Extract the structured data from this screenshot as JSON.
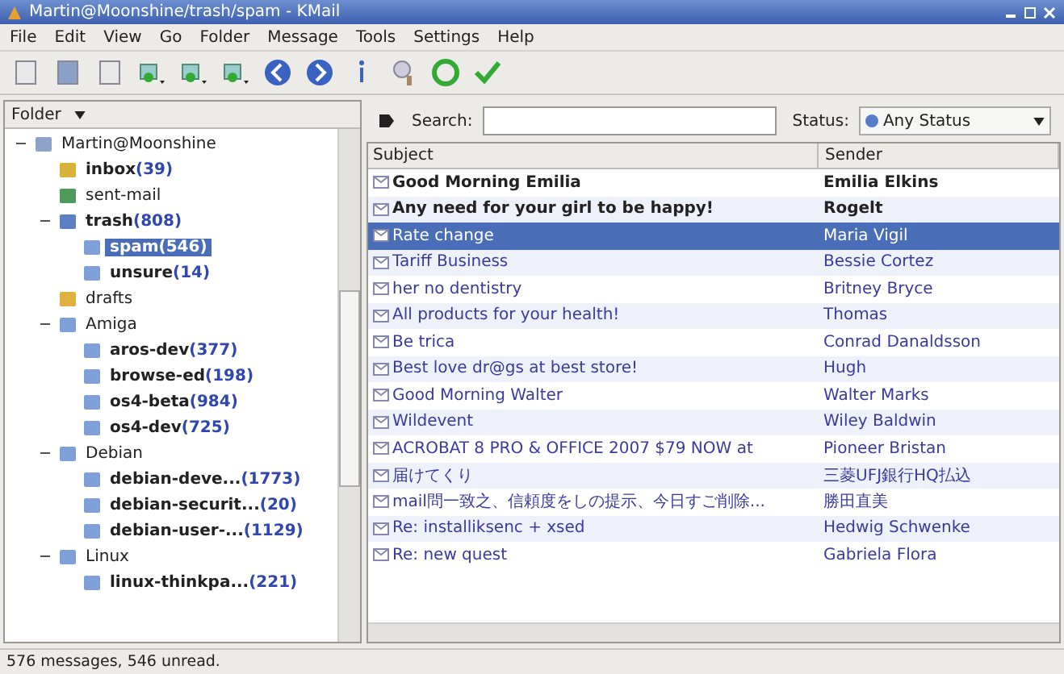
{
  "window": {
    "title": "Martin@Moonshine/trash/spam - KMail"
  },
  "menu": [
    "File",
    "Edit",
    "View",
    "Go",
    "Folder",
    "Message",
    "Tools",
    "Settings",
    "Help"
  ],
  "folder_pane": {
    "header": "Folder",
    "folders": [
      {
        "name": "Martin@Moonshine",
        "kind": "account",
        "expanded": true,
        "selected": false,
        "children": [
          {
            "name": "inbox",
            "count": "(39)",
            "kind": "inbox",
            "selected": false
          },
          {
            "name": "sent-mail",
            "kind": "sent",
            "selected": false
          },
          {
            "name": "trash",
            "count": "(808)",
            "kind": "trash",
            "expanded": true,
            "selected": false,
            "children": [
              {
                "name": "spam",
                "count": "(546)",
                "kind": "folder",
                "selected": true
              },
              {
                "name": "unsure",
                "count": "(14)",
                "kind": "folder",
                "selected": false
              }
            ]
          },
          {
            "name": "drafts",
            "kind": "drafts",
            "selected": false
          },
          {
            "name": "Amiga",
            "kind": "folder",
            "expanded": true,
            "selected": false,
            "children": [
              {
                "name": "aros-dev",
                "count": "(377)",
                "kind": "folder",
                "selected": false
              },
              {
                "name": "browse-ed",
                "count": "(198)",
                "kind": "folder",
                "selected": false
              },
              {
                "name": "os4-beta",
                "count": "(984)",
                "kind": "folder",
                "selected": false
              },
              {
                "name": "os4-dev",
                "count": "(725)",
                "kind": "folder",
                "selected": false
              }
            ]
          },
          {
            "name": "Debian",
            "kind": "folder",
            "expanded": true,
            "selected": false,
            "children": [
              {
                "name": "debian-deve...",
                "count": "(1773)",
                "kind": "folder",
                "selected": false
              },
              {
                "name": "debian-securit...",
                "count": "(20)",
                "kind": "folder",
                "selected": false
              },
              {
                "name": "debian-user-...",
                "count": "(1129)",
                "kind": "folder",
                "selected": false
              }
            ]
          },
          {
            "name": "Linux",
            "kind": "folder",
            "expanded": true,
            "selected": false,
            "children": [
              {
                "name": "linux-thinkpa...",
                "count": "(221)",
                "kind": "folder",
                "selected": false
              }
            ]
          }
        ]
      }
    ]
  },
  "search": {
    "label": "Search:",
    "status_label": "Status:",
    "status_value": "Any Status"
  },
  "table": {
    "columns": [
      "Subject",
      "Sender"
    ],
    "rows": [
      {
        "subject": "Good Morning Emilia",
        "sender": "Emilia Elkins",
        "unread": true,
        "selected": false
      },
      {
        "subject": "Any need for your girl to be happy!",
        "sender": "Rogelt",
        "unread": true,
        "selected": false
      },
      {
        "subject": "Rate change",
        "sender": "Maria Vigil",
        "unread": false,
        "selected": true
      },
      {
        "subject": "Tariff Business",
        "sender": "Bessie Cortez",
        "unread": false,
        "selected": false
      },
      {
        "subject": "her no dentistry",
        "sender": "Britney Bryce",
        "unread": false,
        "selected": false
      },
      {
        "subject": "All products for your health!",
        "sender": "Thomas",
        "unread": false,
        "selected": false
      },
      {
        "subject": "Be trica",
        "sender": "Conrad Danaldsson",
        "unread": false,
        "selected": false
      },
      {
        "subject": "Best love dr@gs at best store!",
        "sender": "Hugh",
        "unread": false,
        "selected": false
      },
      {
        "subject": "Good Morning Walter",
        "sender": "Walter Marks",
        "unread": false,
        "selected": false
      },
      {
        "subject": "Wildevent",
        "sender": "Wiley Baldwin",
        "unread": false,
        "selected": false
      },
      {
        "subject": "ACROBAT 8 PRO & OFFICE 2007 $79 NOW at",
        "sender": "Pioneer Bristan",
        "unread": false,
        "selected": false
      },
      {
        "subject": "届けてくり",
        "sender": "三菱UFJ銀行HQ払込",
        "unread": false,
        "selected": false
      },
      {
        "subject": "mail問一致之、信頼度をしの提示、今日すご削除...",
        "sender": "勝田直美",
        "unread": false,
        "selected": false
      },
      {
        "subject": "Re: installiksenc + xsed",
        "sender": "Hedwig Schwenke",
        "unread": false,
        "selected": false
      },
      {
        "subject": "Re: new quest",
        "sender": "Gabriela Flora",
        "unread": false,
        "selected": false
      }
    ]
  },
  "status_bar": "576 messages, 546 unread."
}
